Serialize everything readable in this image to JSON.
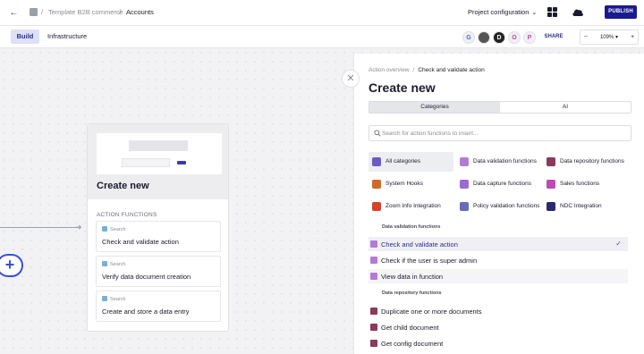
{
  "topbar": {
    "back_icon": "back-arrow-icon",
    "project": "Template B2B commerce",
    "separator": "/",
    "current": "Accounts",
    "project_config": "Project configuration",
    "publish_label": "PUBLISH"
  },
  "subbar": {
    "tabs": [
      "Build",
      "Infrastructure"
    ],
    "avatars": [
      "G",
      "",
      "D",
      "O",
      "P"
    ],
    "share_label": "SHARE",
    "zoom": "109%",
    "zoom_minus": "−",
    "zoom_plus": "+"
  },
  "node": {
    "title": "Create new",
    "section": "ACTION FUNCTIONS",
    "items": [
      {
        "tag": "Search",
        "label": "Check and validate action"
      },
      {
        "tag": "Search",
        "label": "Verify data document creation"
      },
      {
        "tag": "Search",
        "label": "Create and store a data entry"
      }
    ]
  },
  "panel": {
    "crumb_parent": "Action overview",
    "crumb_sep": "/",
    "crumb_current": "Check and validate action",
    "title": "Create new",
    "tabs": [
      "Categories",
      "AI"
    ],
    "search_placeholder": "Search for action functions to insert...",
    "categories": [
      {
        "label": "All categories",
        "icon": "all-categories-icon",
        "color": "#6b5cc4"
      },
      {
        "label": "Data validation functions",
        "icon": "data-validation-icon",
        "color": "#b47bd6"
      },
      {
        "label": "Data repository functions",
        "icon": "data-repository-icon",
        "color": "#8a3a5a"
      },
      {
        "label": "System Hooks",
        "icon": "system-hooks-icon",
        "color": "#d06a2a"
      },
      {
        "label": "Data capture functions",
        "icon": "data-capture-icon",
        "color": "#9a6ad0"
      },
      {
        "label": "Sales functions",
        "icon": "sales-icon",
        "color": "#c04ab0"
      },
      {
        "label": "Zoom Info Integration",
        "icon": "zoominfo-icon",
        "color": "#d8402a"
      },
      {
        "label": "Policy validation functions",
        "icon": "policy-validation-icon",
        "color": "#6a6ab8"
      },
      {
        "label": "NDC Integration",
        "icon": "ndc-icon",
        "color": "#2a2a6a"
      }
    ],
    "sections": [
      {
        "heading": "Data validation functions",
        "items": [
          "Check and validate action",
          "Check if the user is super admin",
          "View data in function"
        ]
      },
      {
        "heading": "Data repository functions",
        "items": [
          "Duplicate one or more documents",
          "Get child document",
          "Get config document"
        ]
      }
    ]
  }
}
